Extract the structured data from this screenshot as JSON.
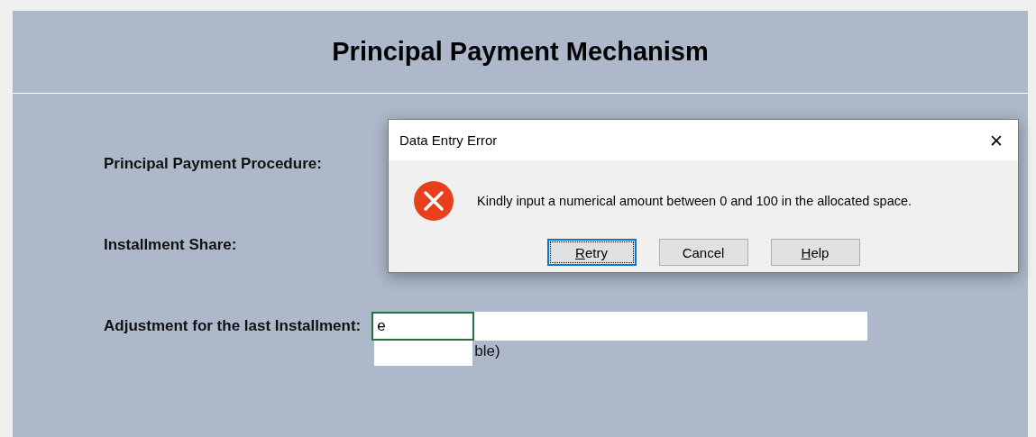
{
  "sheet": {
    "title": "Principal Payment Mechanism",
    "fields": [
      {
        "label": "Principal Payment Procedure:"
      },
      {
        "label": "Installment Share:"
      },
      {
        "label": "Adjustment for the last Installment:",
        "value": "e",
        "focused": true,
        "hint_fragment": "ble)"
      }
    ]
  },
  "dialog": {
    "title": "Data Entry Error",
    "close": "✕",
    "kind": "error",
    "message": "Kindly input a numerical amount between 0 and 100 in the allocated space.",
    "buttons": [
      {
        "label": "Retry",
        "focused": true,
        "mnemonic": true
      },
      {
        "label": "Cancel",
        "focused": false,
        "mnemonic": false
      },
      {
        "label": "Help",
        "focused": false,
        "mnemonic": true
      }
    ]
  }
}
